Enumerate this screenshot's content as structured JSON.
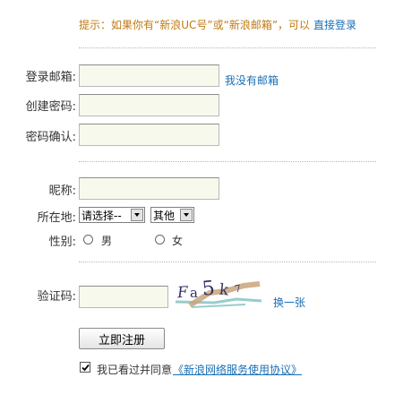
{
  "hint": {
    "text": "提示：如果你有“新浪UC号”或“新浪邮箱”，可以",
    "link": "直接登录"
  },
  "fields": {
    "email_label": "登录邮箱:",
    "email_value": "",
    "no_email_link": "我没有邮箱",
    "password_label": "创建密码:",
    "password_value": "",
    "confirm_label": "密码确认:",
    "confirm_value": "",
    "nickname_label": "昵称:",
    "nickname_value": "",
    "location_label": "所在地:",
    "province_selected": "请选择--",
    "city_selected": "其他",
    "gender_label": "性别:",
    "gender_male": "男",
    "gender_female": "女",
    "captcha_label": "验证码:",
    "captcha_value": "",
    "captcha_chars": [
      "F",
      "a",
      "5",
      "k",
      "7"
    ],
    "refresh_link": "换一张"
  },
  "submit_label": "立即注册",
  "agreement": {
    "checked": true,
    "text": "我已看过并同意",
    "link": "《新浪网络服务使用协议》"
  },
  "colors": {
    "hint": "#c07a12",
    "link": "#1a6fb3",
    "field_bg": "#f6f9ec",
    "captcha_text": "#333366"
  }
}
